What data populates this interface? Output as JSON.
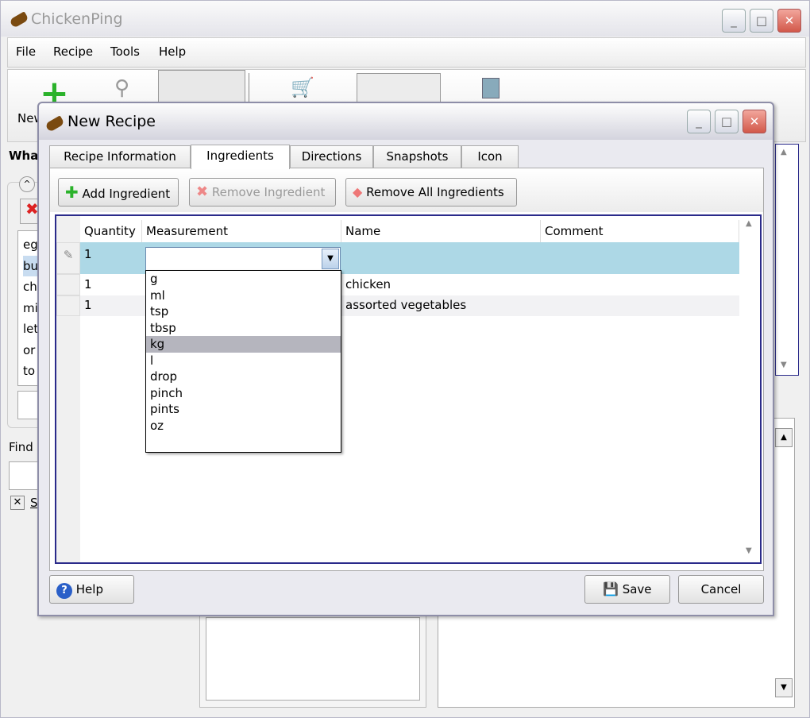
{
  "app": {
    "title": "ChickenPing",
    "menu": [
      "File",
      "Recipe",
      "Tools",
      "Help"
    ],
    "toolbar_new": "New",
    "left_heading": "Wha",
    "ingredients_partial": [
      "eg",
      "bu",
      "ch",
      "mi",
      "let",
      "or",
      "to"
    ],
    "find_label": "Find",
    "check_label": "S"
  },
  "dialog": {
    "title": "New Recipe",
    "tabs": [
      "Recipe Information",
      "Ingredients",
      "Directions",
      "Snapshots",
      "Icon"
    ],
    "toolbar": {
      "add": "Add Ingredient",
      "remove": "Remove Ingredient",
      "remove_all": "Remove All Ingredients"
    },
    "columns": [
      "Quantity",
      "Measurement",
      "Name",
      "Comment"
    ],
    "rows": [
      {
        "quantity": "1",
        "measurement": "",
        "name": "",
        "comment": ""
      },
      {
        "quantity": "1",
        "measurement": "",
        "name": "chicken",
        "comment": ""
      },
      {
        "quantity": "1",
        "measurement": "",
        "name": "assorted vegetables",
        "comment": ""
      }
    ],
    "measurement_options": [
      "g",
      "ml",
      "tsp",
      "tbsp",
      "kg",
      "l",
      "drop",
      "pinch",
      "pints",
      "oz"
    ],
    "highlighted_option": "kg",
    "help": "Help",
    "save": "Save",
    "cancel": "Cancel"
  },
  "colors": {
    "selected_row": "#add8e6",
    "grid_border": "#2a2a8a"
  }
}
